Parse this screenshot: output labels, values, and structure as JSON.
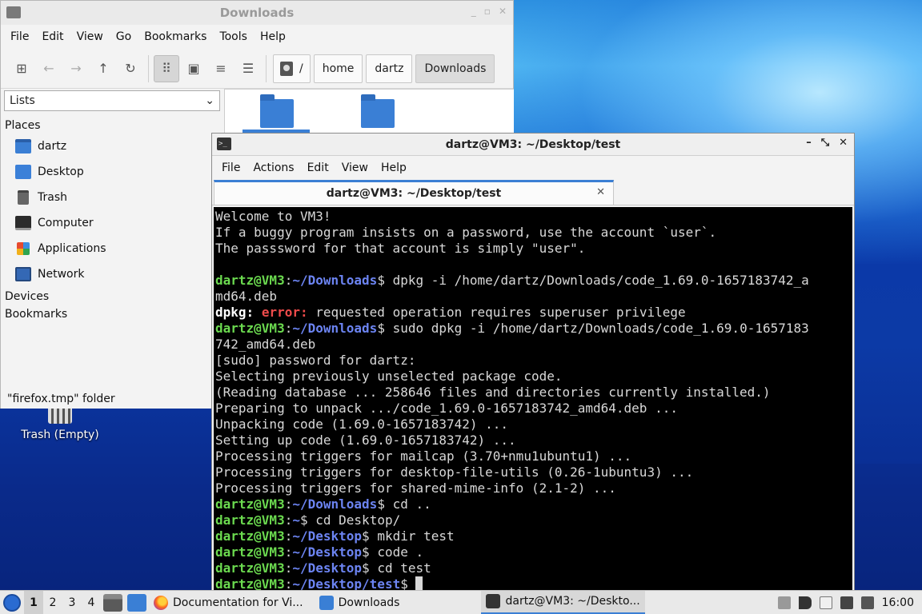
{
  "file_manager": {
    "title": "Downloads",
    "menu": [
      "File",
      "Edit",
      "View",
      "Go",
      "Bookmarks",
      "Tools",
      "Help"
    ],
    "breadcrumb": {
      "root": "/",
      "parts": [
        "home",
        "dartz",
        "Downloads"
      ]
    },
    "side_mode": "Lists",
    "places_header": "Places",
    "places": [
      "dartz",
      "Desktop",
      "Trash",
      "Computer",
      "Applications",
      "Network"
    ],
    "devices_header": "Devices",
    "bookmarks_header": "Bookmarks",
    "status": "\"firefox.tmp\" folder"
  },
  "desktop": {
    "trash_label": "Trash (Empty)"
  },
  "terminal": {
    "title": "dartz@VM3: ~/Desktop/test",
    "menu": [
      "File",
      "Actions",
      "Edit",
      "View",
      "Help"
    ],
    "tab_label": "dartz@VM3: ~/Desktop/test",
    "prompt_user": "dartz@VM3",
    "lines": {
      "l1": "Welcome to VM3!",
      "l2": "If a buggy program insists on a password, use the account `user`.",
      "l3": "The passsword for that account is simply \"user\".",
      "c1_path": "~/Downloads",
      "c1_cmd": " dpkg -i /home/dartz/Downloads/code_1.69.0-1657183742_a",
      "c1_wrap": "md64.deb",
      "e_label": "dpkg:",
      "e_err": "error:",
      "e_msg": " requested operation requires superuser privilege",
      "c2_path": "~/Downloads",
      "c2_cmd": " sudo dpkg -i /home/dartz/Downloads/code_1.69.0-1657183",
      "c2_wrap": "742_amd64.deb",
      "o1": "[sudo] password for dartz:",
      "o2": "Selecting previously unselected package code.",
      "o3": "(Reading database ... 258646 files and directories currently installed.)",
      "o4": "Preparing to unpack .../code_1.69.0-1657183742_amd64.deb ...",
      "o5": "Unpacking code (1.69.0-1657183742) ...",
      "o6": "Setting up code (1.69.0-1657183742) ...",
      "o7": "Processing triggers for mailcap (3.70+nmu1ubuntu1) ...",
      "o8": "Processing triggers for desktop-file-utils (0.26-1ubuntu3) ...",
      "o9": "Processing triggers for shared-mime-info (2.1-2) ...",
      "c3_path": "~/Downloads",
      "c3_cmd": " cd ..",
      "c4_path": "~",
      "c4_cmd": " cd Desktop/",
      "c5_path": "~/Desktop",
      "c5_cmd": " mkdir test",
      "c6_path": "~/Desktop",
      "c6_cmd": " code .",
      "c7_path": "~/Desktop",
      "c7_cmd": " cd test",
      "c8_path": "~/Desktop/test",
      "c8_cmd": " "
    }
  },
  "taskbar": {
    "workspaces": [
      "1",
      "2",
      "3",
      "4"
    ],
    "tasks": [
      "Documentation for Vi...",
      "Downloads",
      "dartz@VM3: ~/Deskto..."
    ],
    "clock": "16:00"
  },
  "colors": {
    "prompt_user": "#6bd94f",
    "prompt_path": "#6c84f2",
    "error": "#ee4b4b",
    "accent": "#3b7fd4"
  }
}
